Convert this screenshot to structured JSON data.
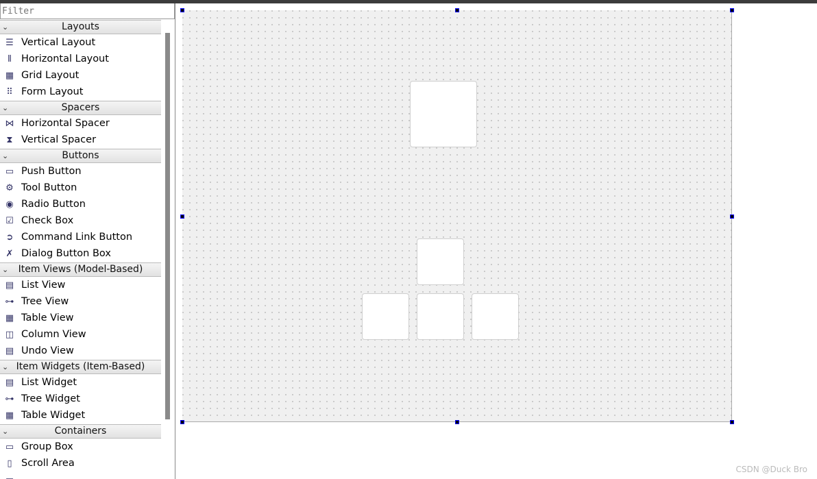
{
  "filter": {
    "placeholder": "Filter"
  },
  "categories": [
    {
      "label": "Layouts",
      "items": [
        {
          "label": "Vertical Layout",
          "icon": "vertical-layout-icon"
        },
        {
          "label": "Horizontal Layout",
          "icon": "horizontal-layout-icon"
        },
        {
          "label": "Grid Layout",
          "icon": "grid-layout-icon"
        },
        {
          "label": "Form Layout",
          "icon": "form-layout-icon"
        }
      ]
    },
    {
      "label": "Spacers",
      "items": [
        {
          "label": "Horizontal Spacer",
          "icon": "horizontal-spacer-icon"
        },
        {
          "label": "Vertical Spacer",
          "icon": "vertical-spacer-icon"
        }
      ]
    },
    {
      "label": "Buttons",
      "items": [
        {
          "label": "Push Button",
          "icon": "push-button-icon"
        },
        {
          "label": "Tool Button",
          "icon": "tool-button-icon"
        },
        {
          "label": "Radio Button",
          "icon": "radio-button-icon"
        },
        {
          "label": "Check Box",
          "icon": "check-box-icon"
        },
        {
          "label": "Command Link Button",
          "icon": "command-link-icon"
        },
        {
          "label": "Dialog Button Box",
          "icon": "dialog-button-box-icon"
        }
      ]
    },
    {
      "label": "Item Views (Model-Based)",
      "items": [
        {
          "label": "List View",
          "icon": "list-view-icon"
        },
        {
          "label": "Tree View",
          "icon": "tree-view-icon"
        },
        {
          "label": "Table View",
          "icon": "table-view-icon"
        },
        {
          "label": "Column View",
          "icon": "column-view-icon"
        },
        {
          "label": "Undo View",
          "icon": "undo-view-icon"
        }
      ]
    },
    {
      "label": "Item Widgets (Item-Based)",
      "items": [
        {
          "label": "List Widget",
          "icon": "list-widget-icon"
        },
        {
          "label": "Tree Widget",
          "icon": "tree-widget-icon"
        },
        {
          "label": "Table Widget",
          "icon": "table-widget-icon"
        }
      ]
    },
    {
      "label": "Containers",
      "items": [
        {
          "label": "Group Box",
          "icon": "group-box-icon"
        },
        {
          "label": "Scroll Area",
          "icon": "scroll-area-icon"
        },
        {
          "label": "",
          "icon": "tool-box-icon"
        }
      ]
    }
  ],
  "watermark": "CSDN @Duck Bro"
}
